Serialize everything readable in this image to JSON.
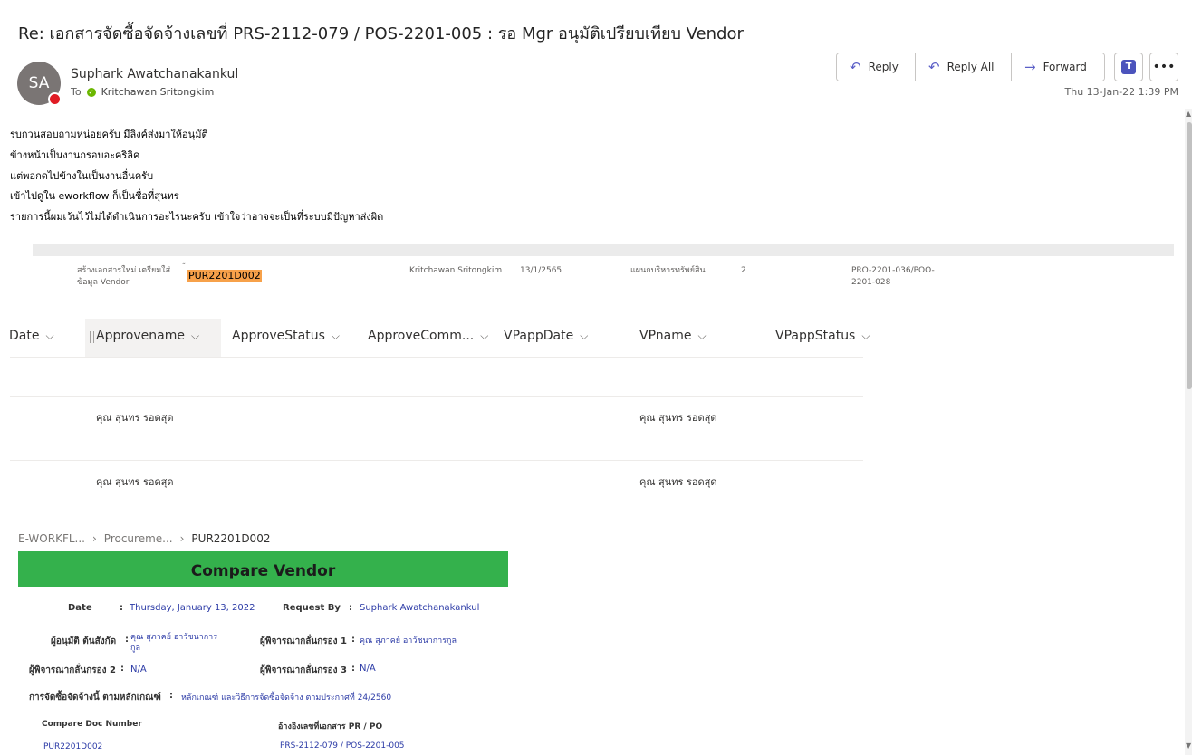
{
  "subject": "Re: เอกสารจัดซื้อจัดจ้างเลขที่ PRS-2112-079 / POS-2201-005 : รอ Mgr อนุมัติเปรียบเทียบ Vendor",
  "sender": {
    "initials": "SA",
    "name": "Suphark Awatchanakankul",
    "to_label": "To",
    "to_name": "Kritchawan Sritongkim"
  },
  "actions": {
    "reply": "Reply",
    "reply_all": "Reply All",
    "forward": "Forward"
  },
  "timestamp": "Thu 13-Jan-22 1:39 PM",
  "body_lines": [
    "รบกวนสอบถามหน่อยครับ มีลิงค์ส่งมาให้อนุมัติ",
    "ข้างหน้าเป็นงานกรอบอะคริลิค",
    "แต่พอกดไปข้างในเป็นงานอื่นครับ",
    "เข้าไปดูใน eworkflow ก็เป็นชื่อที่สุนทร",
    "รายการนี้ผมเว้นไว้ไม่ได้ดำเนินการอะไรนะครับ เข้าใจว่าอาจจะเป็นที่ระบบมีปัญหาส่งผิด"
  ],
  "list_row": {
    "status_line1": "สร้างเอกสารใหม่ เตรียมใส่",
    "status_line2": "ข้อมูล Vendor",
    "doc_no": "PUR2201D002",
    "owner": "Kritchawan Sritongkim",
    "date": "13/1/2565",
    "department": "แผนกบริหารทรัพย์สิน",
    "count": "2",
    "ref_line1": "PRO-2201-036/POO-",
    "ref_line2": "2201-028"
  },
  "columns": [
    "Date",
    "Approvename",
    "ApproveStatus",
    "ApproveComm...",
    "VPappDate",
    "VPname",
    "VPappStatus"
  ],
  "table_rows": [
    {
      "approvename": "คุณ สุนทร รอดสุด",
      "vpname": "คุณ สุนทร รอดสุด"
    },
    {
      "approvename": "คุณ สุนทร รอดสุด",
      "vpname": "คุณ สุนทร รอดสุด"
    }
  ],
  "breadcrumb": [
    "E-WORKFL...",
    "Procureme...",
    "PUR2201D002"
  ],
  "form": {
    "banner": "Compare Vendor",
    "date_label": "Date",
    "date_value": "Thursday, January 13, 2022",
    "request_by_label": "Request By",
    "request_by_value": "Suphark Awatchanakankul",
    "approver_label": "ผู้อนุมัติ ต้นสังกัด",
    "approver_value": "คุณ สุภาคย์ อาวัชนาการกูล",
    "screen1_label": "ผู้พิจารณากลั่นกรอง 1",
    "screen1_value": "คุณ สุภาคย์ อาวัชนาการกูล",
    "screen2_label": "ผู้พิจารณากลั่นกรอง 2",
    "screen2_value": "N/A",
    "screen3_label": "ผู้พิจารณากลั่นกรอง 3",
    "screen3_value": "N/A",
    "criteria_label": "การจัดซื้อจัดจ้างนี้ ตามหลักเกณฑ์",
    "criteria_value": "หลักเกณฑ์ และวิธีการจัดซื้อจัดจ้าง ตามประกาศที่ 24/2560",
    "compare_doc_label": "Compare Doc Number",
    "compare_doc_value": "PUR2201D002",
    "ref_doc_label": "อ้างอิงเลขที่เอกสาร PR / PO",
    "ref_doc_value": "PRS-2112-079 / POS-2201-005",
    "colon": ":"
  }
}
